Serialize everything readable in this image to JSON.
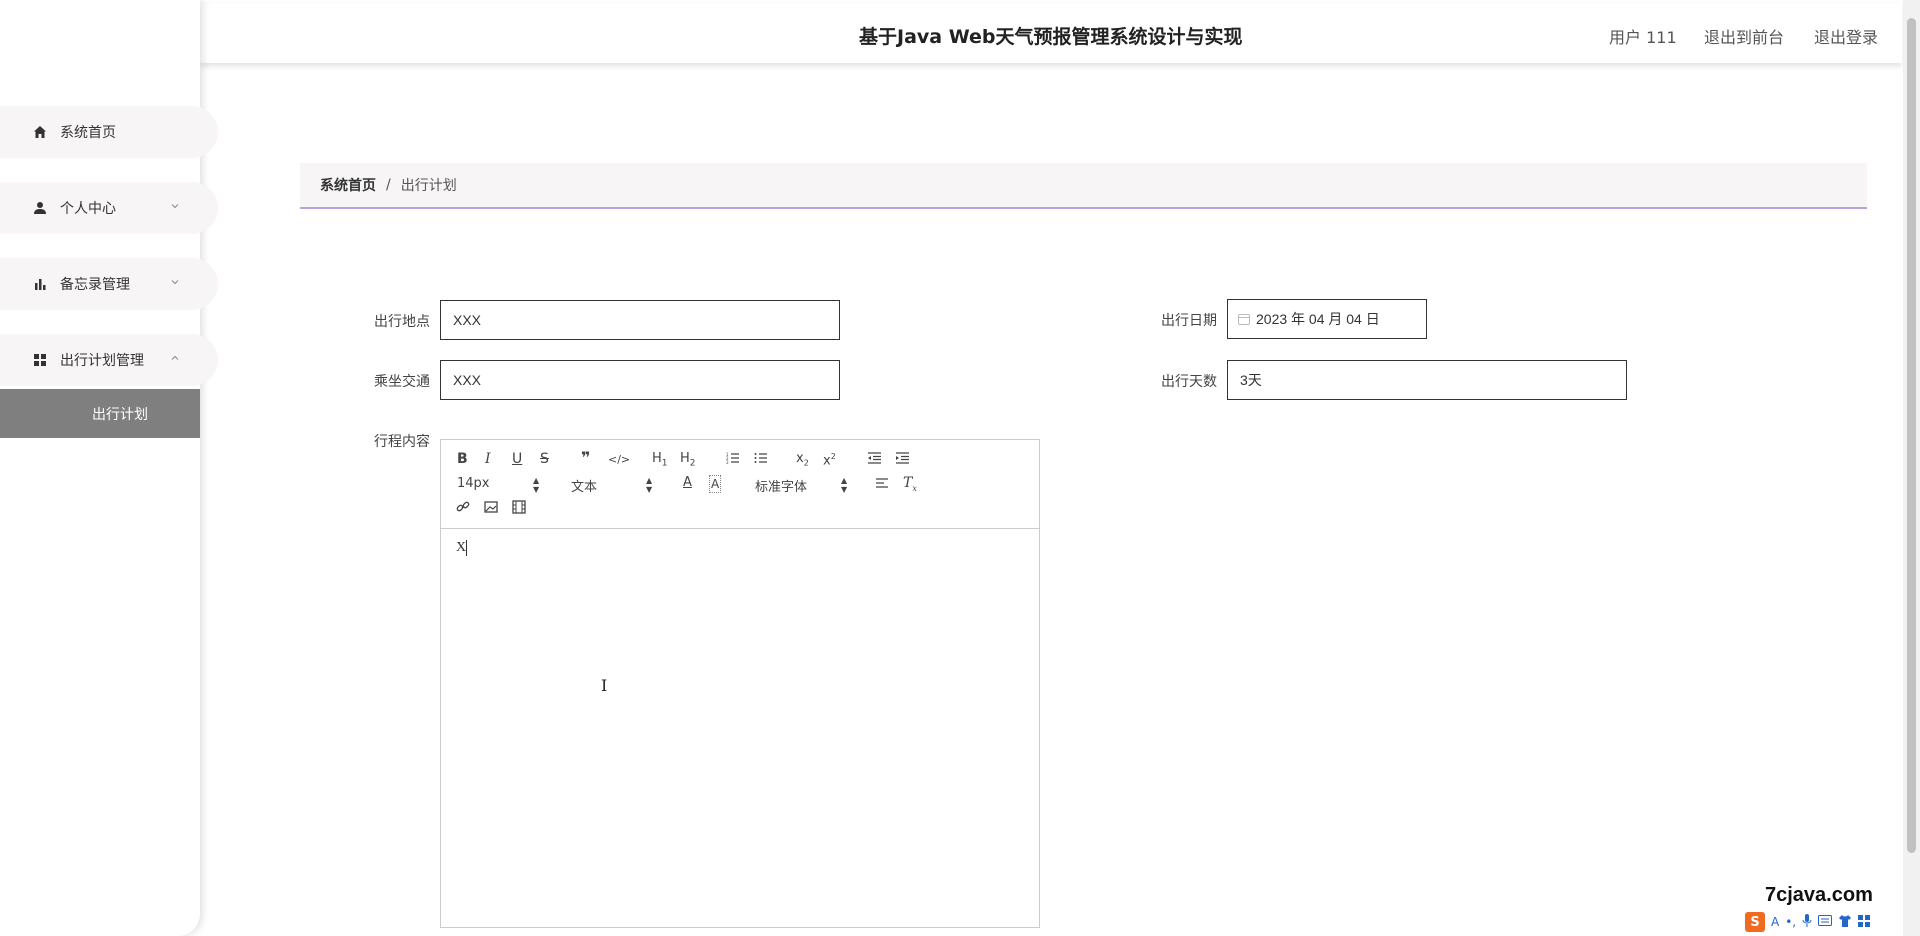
{
  "header": {
    "app_title": "基于Java Web天气预报管理系统设计与实现",
    "user": "用户 111",
    "back_front": "退出到前台",
    "logout": "退出登录"
  },
  "sidebar": {
    "items": [
      {
        "label": "系统首页",
        "icon": "home-icon"
      },
      {
        "label": "个人中心",
        "icon": "user-icon"
      },
      {
        "label": "备忘录管理",
        "icon": "bar-chart-icon"
      },
      {
        "label": "出行计划管理",
        "icon": "grid-icon"
      }
    ],
    "submenu_active": "出行计划"
  },
  "breadcrumb": {
    "home": "系统首页",
    "separator": "/",
    "current": "出行计划"
  },
  "form": {
    "location_label": "出行地点",
    "location_value": "XXX",
    "transport_label": "乘坐交通",
    "transport_value": "XXX",
    "date_label": "出行日期",
    "date_value": "2023 年 04 月 04 日",
    "days_label": "出行天数",
    "days_value": "3天",
    "content_label": "行程内容"
  },
  "editor": {
    "size_select": "14px",
    "format_select": "文本",
    "font_select": "标准字体",
    "content_text": "X"
  },
  "watermark": "7cjava.com",
  "ime": {
    "logo": "S",
    "mode": "A"
  },
  "colors": {
    "active_submenu_bg": "#7f7f7f",
    "breadcrumb_underline": "#b8a3df",
    "menu_item_bg": "#f7f5f6"
  }
}
